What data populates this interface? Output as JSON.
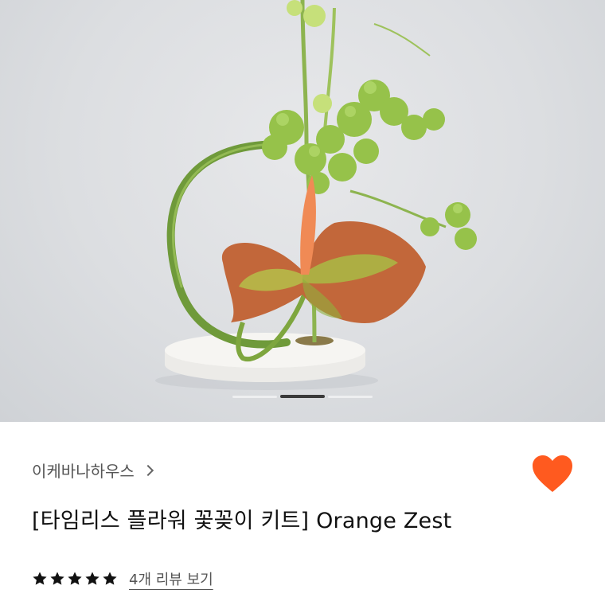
{
  "product": {
    "seller_name": "이케바나하우스",
    "title": "[타임리스 플라워 꽃꽂이 키트] Orange Zest",
    "rating_stars": 5,
    "reviews_link": "4개 리뷰 보기",
    "wishlisted": true
  },
  "gallery": {
    "image_subject": "ikebana-flower-arrangement",
    "slide_count": 3,
    "active_slide": 2
  },
  "colors": {
    "wishlist_heart": "#FF5A1F",
    "star": "#111111",
    "title_text": "#111111",
    "secondary_text": "#555555"
  }
}
